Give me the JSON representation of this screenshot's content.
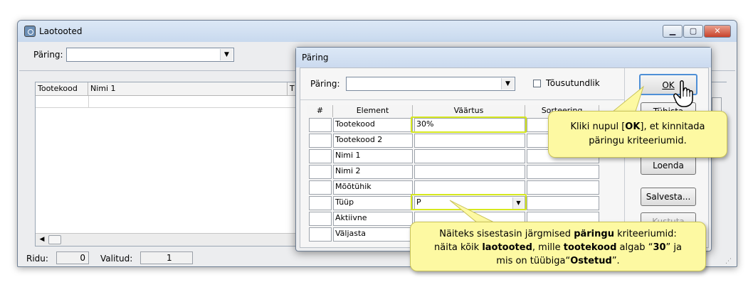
{
  "main_window": {
    "title": "Laotooted",
    "query_label": "Päring:",
    "columns": [
      "Tootekood",
      "Nimi 1",
      "T"
    ],
    "status": {
      "rows_label": "Ridu:",
      "rows_value": "0",
      "selected_label": "Valitud:",
      "selected_value": "1"
    }
  },
  "dialog": {
    "title": "Päring",
    "query_label": "Päring:",
    "ascending_label": "Tõusutundlik",
    "grid_headers": [
      "#",
      "Element",
      "Väärtus",
      "Sorteering"
    ],
    "rows": [
      {
        "element": "Tootekood",
        "value": "30%"
      },
      {
        "element": "Tootekood 2",
        "value": ""
      },
      {
        "element": "Nimi 1",
        "value": ""
      },
      {
        "element": "Nimi 2",
        "value": ""
      },
      {
        "element": "Mõõtühik",
        "value": ""
      },
      {
        "element": "Tüüp",
        "value": "P"
      },
      {
        "element": "Aktiivne",
        "value": ""
      },
      {
        "element": "Väljasta",
        "value": ""
      }
    ],
    "buttons": {
      "ok": "OK",
      "cancel": "Tühista",
      "list": "Loenda",
      "save": "Salvesta...",
      "delete": "Kustuta"
    }
  },
  "callouts": {
    "ok_parts": [
      "Kliki nupul [",
      "OK",
      "], et kinnitada",
      "päringu kriteeriumid."
    ],
    "example_parts": [
      "Näiteks sisestasin järgmised ",
      "päringu",
      " kriteeriumid:",
      "näita kõik ",
      "laotooted",
      ", mille ",
      "tootekood",
      " algab “",
      "30",
      "” ja",
      "mis on tüübiga“",
      "Ostetud",
      "”."
    ]
  },
  "colors": {
    "callout_bg": "#fdf9a2",
    "highlight": "#d6e81f",
    "titlebar": "#dce8f6"
  }
}
